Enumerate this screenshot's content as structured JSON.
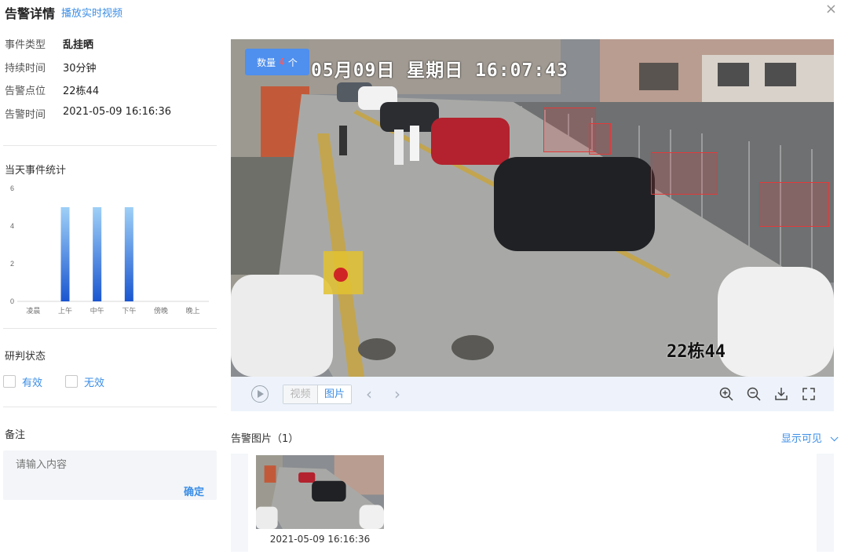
{
  "header": {
    "title": "告警详情",
    "live_link": "播放实时视频",
    "close_label": "×"
  },
  "info": [
    {
      "label": "事件类型",
      "value": "乱挂晒"
    },
    {
      "label": "持续时间",
      "value": "30分钟"
    },
    {
      "label": "告警点位",
      "value": "22栋44"
    },
    {
      "label": "告警时间",
      "value": "2021-05-09 16:16:36"
    }
  ],
  "stats": {
    "title": "当天事件统计"
  },
  "chart_data": {
    "type": "bar",
    "categories": [
      "凌晨",
      "上午",
      "中午",
      "下午",
      "傍晚",
      "晚上"
    ],
    "values": [
      0,
      5,
      5,
      5,
      0,
      0
    ],
    "ylim": [
      0,
      6
    ],
    "yticks": [
      "0",
      "2",
      "4",
      "6"
    ],
    "bar_color_top": "#9fd0f7",
    "bar_color_bottom": "#1a56d0",
    "grid": false
  },
  "status": {
    "title": "研判状态",
    "options": [
      "有效",
      "无效"
    ]
  },
  "remark": {
    "title": "备注",
    "placeholder": "请输入内容",
    "confirm": "确定"
  },
  "video": {
    "count_label": "数量",
    "count_value": "4",
    "count_unit": "个",
    "osd_date": "05月09日 星期日 16:07:43",
    "osd_location": "22栋44"
  },
  "controls": {
    "play_icon": "play-circle-icon",
    "tab_video": "视频",
    "tab_image": "图片",
    "prev": "‹",
    "next": "›",
    "tools": [
      "zoom-in-icon",
      "zoom-out-icon",
      "download-icon",
      "fullscreen-icon"
    ]
  },
  "images": {
    "title": "告警图片（1）",
    "show_visible": "显示可见",
    "items": [
      {
        "time": "2021-05-09 16:16:36"
      }
    ]
  },
  "colors": {
    "accent": "#3b8ee6",
    "badge": "#4f8fee",
    "detection": "#e23a3a"
  }
}
